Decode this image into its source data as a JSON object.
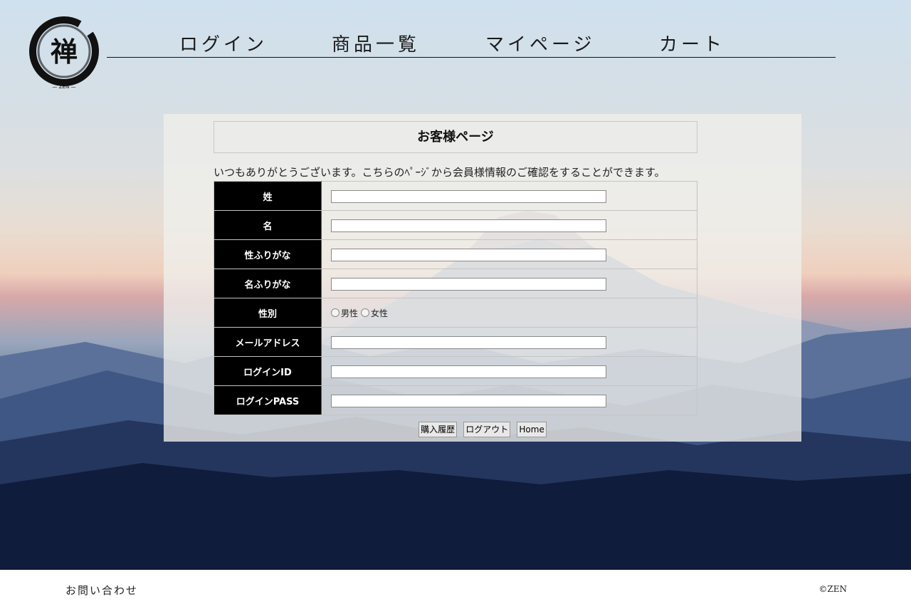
{
  "logo": {
    "icon": "zen-brush-circle-logo",
    "glyph": "禅",
    "sub": "— ZEN —"
  },
  "nav": {
    "items": [
      {
        "label": "ログイン"
      },
      {
        "label": "商品一覧"
      },
      {
        "label": "マイページ"
      },
      {
        "label": "カート"
      }
    ]
  },
  "page": {
    "title": "お客様ページ",
    "intro": "いつもありがとうございます。こちらのﾍﾟｰｼﾞから会員様情報のご確認をすることができます。"
  },
  "form": {
    "rows": [
      {
        "label": "姓",
        "value": ""
      },
      {
        "label": "名",
        "value": ""
      },
      {
        "label": "性ふりがな",
        "value": ""
      },
      {
        "label": "名ふりがな",
        "value": ""
      },
      {
        "label": "性別",
        "options": [
          "男性",
          "女性"
        ]
      },
      {
        "label": "メールアドレス",
        "value": ""
      },
      {
        "label": "ログインID",
        "value": ""
      },
      {
        "label": "ログインPASS",
        "value": ""
      }
    ]
  },
  "buttons": {
    "history": "購入履歴",
    "logout": "ログアウト",
    "home": "Home"
  },
  "footer": {
    "contact": "お問い合わせ",
    "copyright": "©ZEN"
  }
}
